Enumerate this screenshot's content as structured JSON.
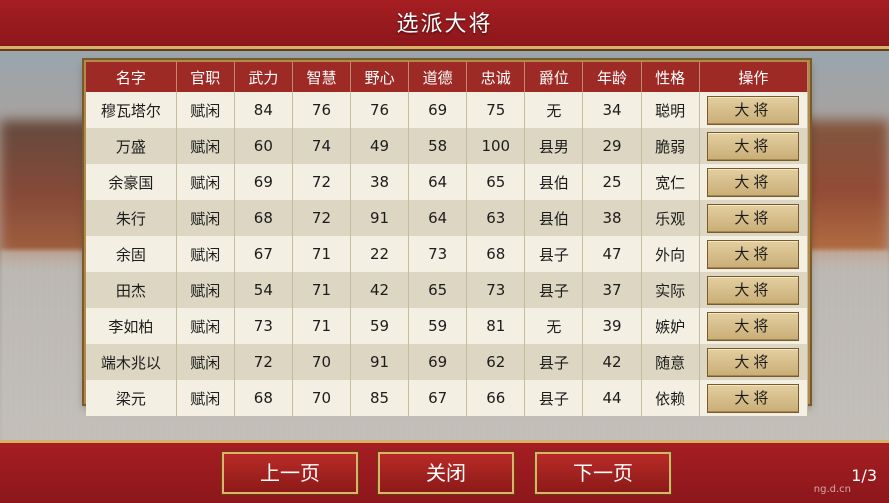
{
  "title": "选派大将",
  "table": {
    "headers": [
      "名字",
      "官职",
      "武力",
      "智慧",
      "野心",
      "道德",
      "忠诚",
      "爵位",
      "年龄",
      "性格",
      "操作"
    ],
    "rows": [
      {
        "name": "穆瓦塔尔",
        "post": "赋闲",
        "force": "84",
        "wisdom": "76",
        "ambition": "76",
        "morality": "69",
        "loyalty": "75",
        "title": "无",
        "age": "34",
        "character": "聪明",
        "action": "大将"
      },
      {
        "name": "万盛",
        "post": "赋闲",
        "force": "60",
        "wisdom": "74",
        "ambition": "49",
        "morality": "58",
        "loyalty": "100",
        "title": "县男",
        "age": "29",
        "character": "脆弱",
        "action": "大将"
      },
      {
        "name": "余豪国",
        "post": "赋闲",
        "force": "69",
        "wisdom": "72",
        "ambition": "38",
        "morality": "64",
        "loyalty": "65",
        "title": "县伯",
        "age": "25",
        "character": "宽仁",
        "action": "大将"
      },
      {
        "name": "朱行",
        "post": "赋闲",
        "force": "68",
        "wisdom": "72",
        "ambition": "91",
        "morality": "64",
        "loyalty": "63",
        "title": "县伯",
        "age": "38",
        "character": "乐观",
        "action": "大将"
      },
      {
        "name": "余固",
        "post": "赋闲",
        "force": "67",
        "wisdom": "71",
        "ambition": "22",
        "morality": "73",
        "loyalty": "68",
        "title": "县子",
        "age": "47",
        "character": "外向",
        "action": "大将"
      },
      {
        "name": "田杰",
        "post": "赋闲",
        "force": "54",
        "wisdom": "71",
        "ambition": "42",
        "morality": "65",
        "loyalty": "73",
        "title": "县子",
        "age": "37",
        "character": "实际",
        "action": "大将"
      },
      {
        "name": "李如柏",
        "post": "赋闲",
        "force": "73",
        "wisdom": "71",
        "ambition": "59",
        "morality": "59",
        "loyalty": "81",
        "title": "无",
        "age": "39",
        "character": "嫉妒",
        "action": "大将"
      },
      {
        "name": "端木兆以",
        "post": "赋闲",
        "force": "72",
        "wisdom": "70",
        "ambition": "91",
        "morality": "69",
        "loyalty": "62",
        "title": "县子",
        "age": "42",
        "character": "随意",
        "action": "大将"
      },
      {
        "name": "梁元",
        "post": "赋闲",
        "force": "68",
        "wisdom": "70",
        "ambition": "85",
        "morality": "67",
        "loyalty": "66",
        "title": "县子",
        "age": "44",
        "character": "依赖",
        "action": "大将"
      }
    ]
  },
  "nav": {
    "prev_label": "上一页",
    "close_label": "关闭",
    "next_label": "下一页",
    "page": "1/3"
  },
  "watermark": "ng.d.cn",
  "colors": {
    "accent_red": "#9e2a25",
    "gold_border": "#d7b06a"
  }
}
